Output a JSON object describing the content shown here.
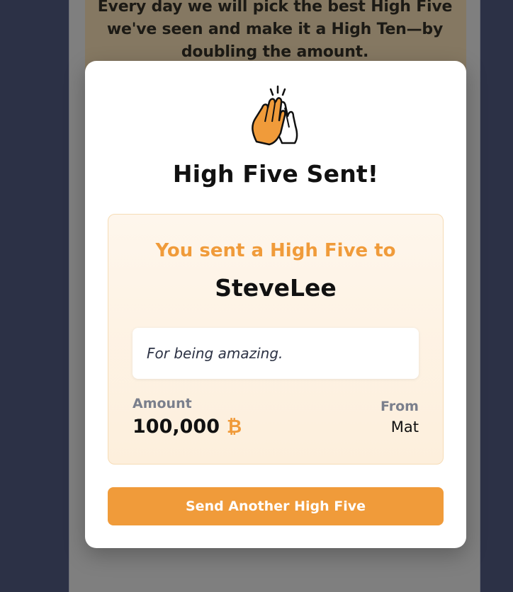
{
  "banner": {
    "text": "Every day we will pick the best High Five we've seen and make it a High Ten—by doubling the amount."
  },
  "modal": {
    "icon": "high-five-hands-icon",
    "title": "High Five Sent!",
    "card": {
      "subtitle": "You sent a High Five to",
      "recipient": "SteveLee",
      "message": "For being amazing.",
      "amount_label": "Amount",
      "amount_value": "100,000",
      "currency_symbol": "₿",
      "from_label": "From",
      "from_value": "Mat"
    },
    "button_label": "Send Another High Five"
  },
  "colors": {
    "accent": "#f09b3a",
    "background": "#2c3146",
    "card_bg": "#fdf1e2"
  }
}
